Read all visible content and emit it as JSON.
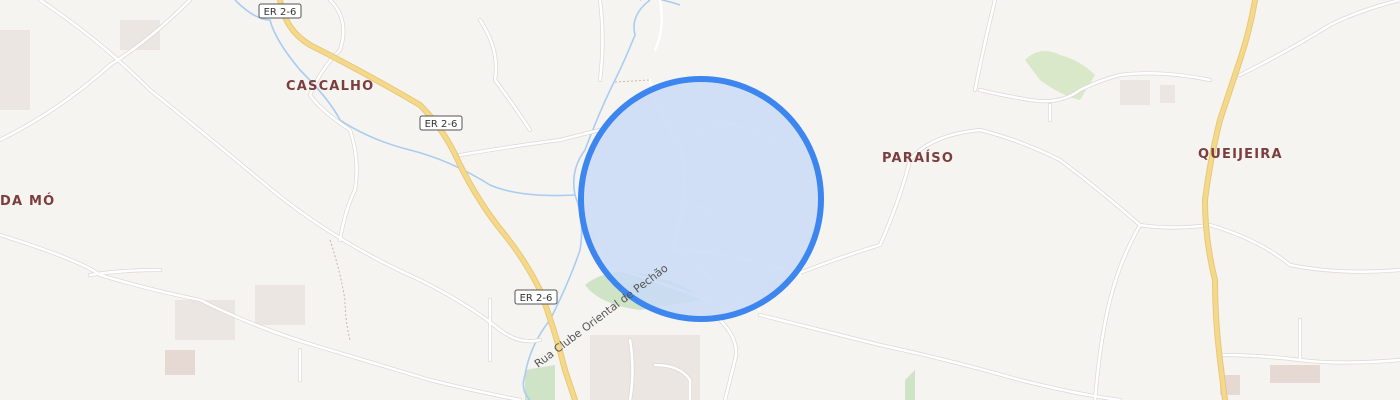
{
  "map": {
    "places": {
      "cascalho": "CASCALHO",
      "da_mo": "DA MÓ",
      "paraiso": "PARAÍSO",
      "queijeira": "QUEIJEIRA"
    },
    "road_shields": {
      "shield_top": "ER 2-6",
      "shield_mid": "ER 2-6",
      "shield_low": "ER 2-6"
    },
    "streets": {
      "rua_clube": "Rua Clube Oriental de Pechão"
    },
    "colors": {
      "background": "#f6f4f1",
      "major_road": "#f5d98b",
      "minor_road": "#ffffff",
      "water": "#a9cdf0",
      "green": "#d8e8c8",
      "location_fill": "#c9daf6",
      "location_stroke": "#3d86f0"
    },
    "location_marker": "radius-circle"
  }
}
